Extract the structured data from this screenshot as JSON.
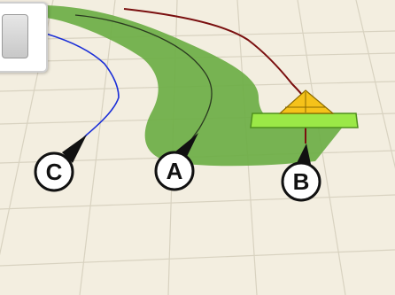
{
  "map_view": {
    "callouts": [
      {
        "id": "C",
        "label": "C",
        "meaning": "guidance-line"
      },
      {
        "id": "A",
        "label": "A",
        "meaning": "guidance-line-center"
      },
      {
        "id": "B",
        "label": "B",
        "meaning": "vehicle-path"
      }
    ]
  },
  "icons": {
    "vehicle": "vehicle-icon",
    "implement": "implement-bar-icon"
  },
  "colors": {
    "ground": "#f3eee0",
    "grid": "#d8d2c0",
    "coverage": "#6dae45",
    "guidance_line_blue": "#1b2fd8",
    "guidance_line_center": "#2a3a20",
    "vehicle_path": "#7a0f0f",
    "implement_bar": "#9be847",
    "vehicle": "#f5c21a",
    "callout_fill": "#ffffff",
    "callout_border": "#111111"
  }
}
